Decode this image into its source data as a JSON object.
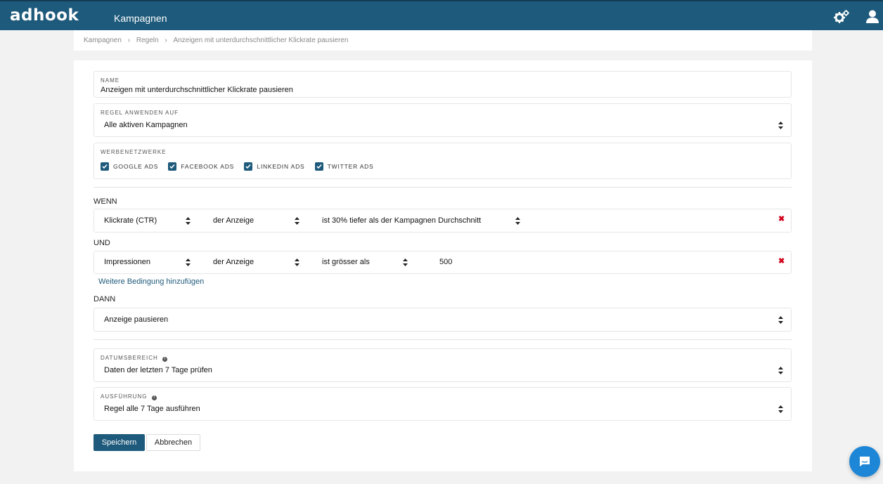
{
  "header": {
    "logo": "adhook",
    "title": "Kampagnen",
    "colors": {
      "bar": "#1e5a7b",
      "accent": "#1e86d6",
      "delete": "#d0021b"
    }
  },
  "breadcrumb": [
    "Kampagnen",
    "Regeln",
    "Anzeigen mit unterdurchschnittlicher Klickrate pausieren"
  ],
  "form": {
    "name": {
      "label": "NAME",
      "value": "Anzeigen mit unterdurchschnittlicher Klickrate pausieren"
    },
    "apply_to": {
      "label": "REGEL ANWENDEN AUF",
      "value": "Alle aktiven Kampagnen"
    },
    "networks": {
      "label": "WERBENETZWERKE",
      "items": [
        {
          "label": "GOOGLE ADS",
          "checked": true
        },
        {
          "label": "FACEBOOK ADS",
          "checked": true
        },
        {
          "label": "LINKEDIN ADS",
          "checked": true
        },
        {
          "label": "TWITTER ADS",
          "checked": true
        }
      ]
    },
    "when_label": "WENN",
    "condition1": {
      "metric": "Klickrate (CTR)",
      "object": "der Anzeige",
      "operator": "ist 30% tiefer als der Kampagnen Durchschnitt"
    },
    "and_label": "UND",
    "condition2": {
      "metric": "Impressionen",
      "object": "der Anzeige",
      "operator": "ist grösser als",
      "value": "500"
    },
    "add_condition": "Weitere Bedingung hinzufügen",
    "then_label": "DANN",
    "action": {
      "value": "Anzeige pausieren"
    },
    "date_range": {
      "label": "DATUMSBEREICH",
      "value": "Daten der letzten 7 Tage prüfen"
    },
    "execution": {
      "label": "AUSFÜHRUNG",
      "value": "Regel alle 7 Tage ausführen"
    },
    "save": "Speichern",
    "cancel": "Abbrechen"
  }
}
